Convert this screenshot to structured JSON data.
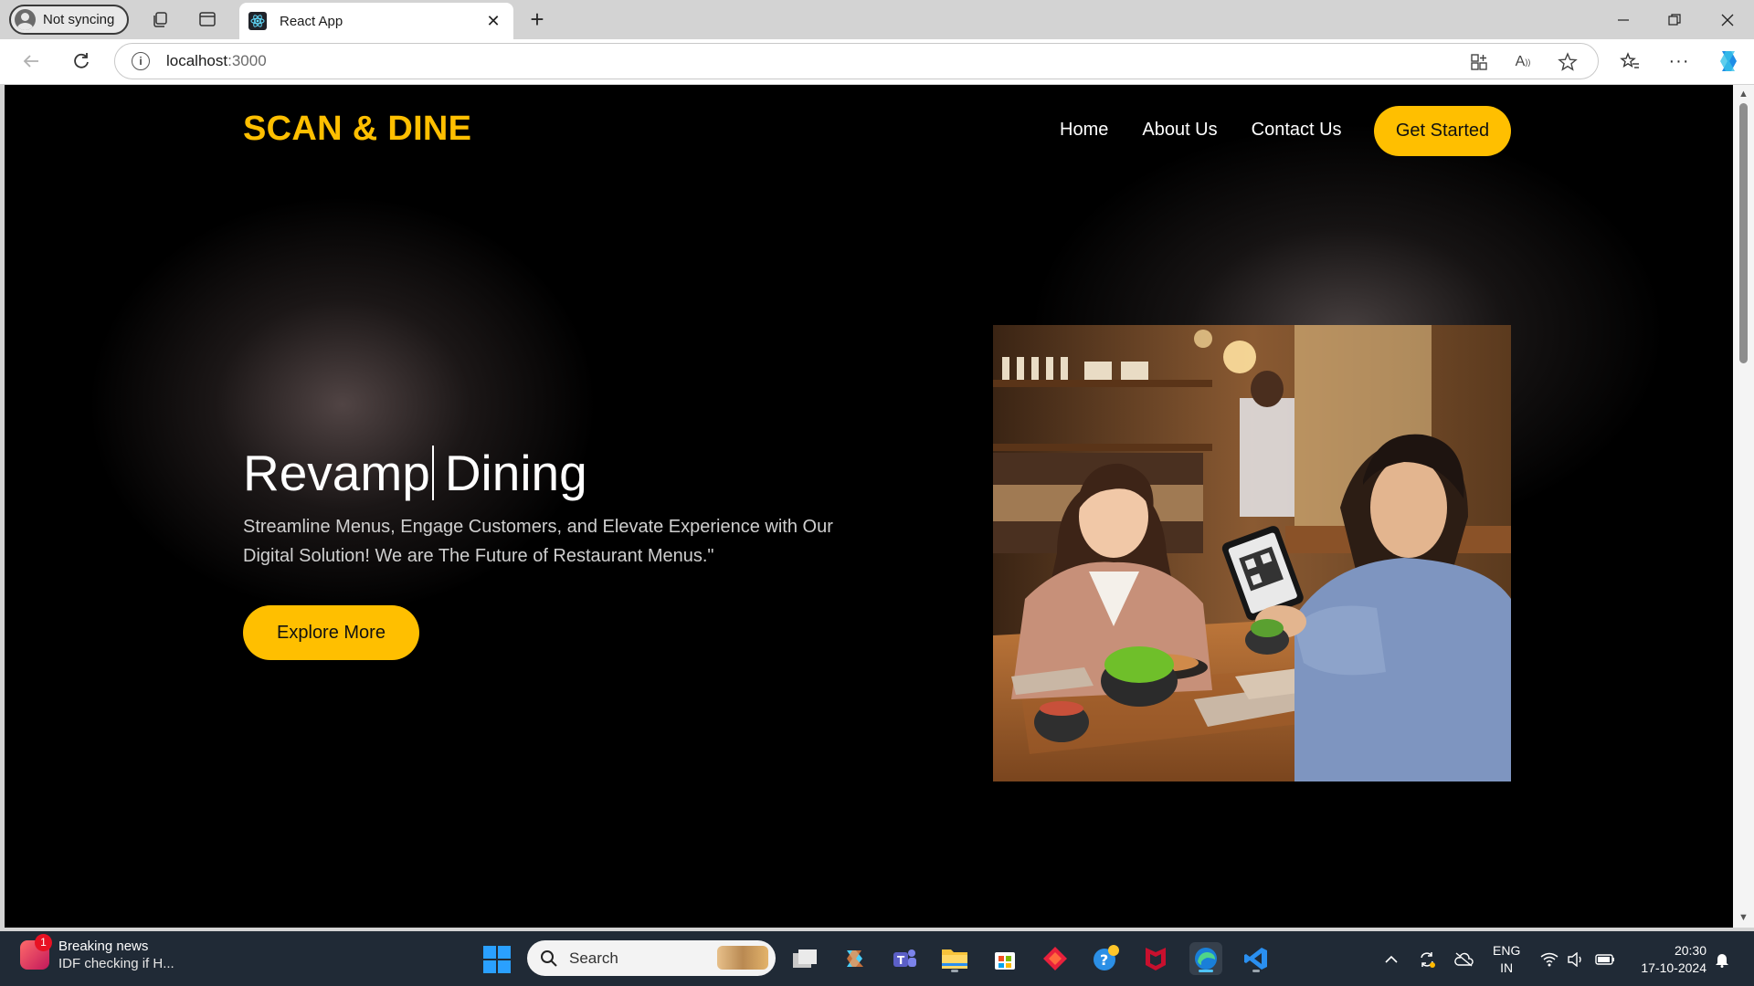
{
  "browser": {
    "profile_label": "Not syncing",
    "tab_title": "React App",
    "address_host": "localhost",
    "address_port": ":3000"
  },
  "page": {
    "logo": "SCAN & DINE",
    "nav": [
      {
        "label": "Home"
      },
      {
        "label": "About Us"
      },
      {
        "label": "Contact Us"
      }
    ],
    "cta_label": "Get Started",
    "hero_title_part1": "Revamp",
    "hero_title_part2": "Dining",
    "hero_subtitle": "Streamline Menus, Engage Customers, and Elevate Experience with Our Digital Solution! We are The Future of Restaurant Menus.\"",
    "hero_button": "Explore More",
    "hero_image_icon": "restaurant-qr-menu-photo"
  },
  "taskbar": {
    "news_badge": "1",
    "news_title": "Breaking news",
    "news_subtitle": "IDF checking if H...",
    "search_label": "Search",
    "lang_line1": "ENG",
    "lang_line2": "IN",
    "time": "20:30",
    "date": "17-10-2024"
  },
  "colors": {
    "accent": "#ffbf00",
    "page_background": "#000000",
    "taskbar": "#202a36"
  }
}
